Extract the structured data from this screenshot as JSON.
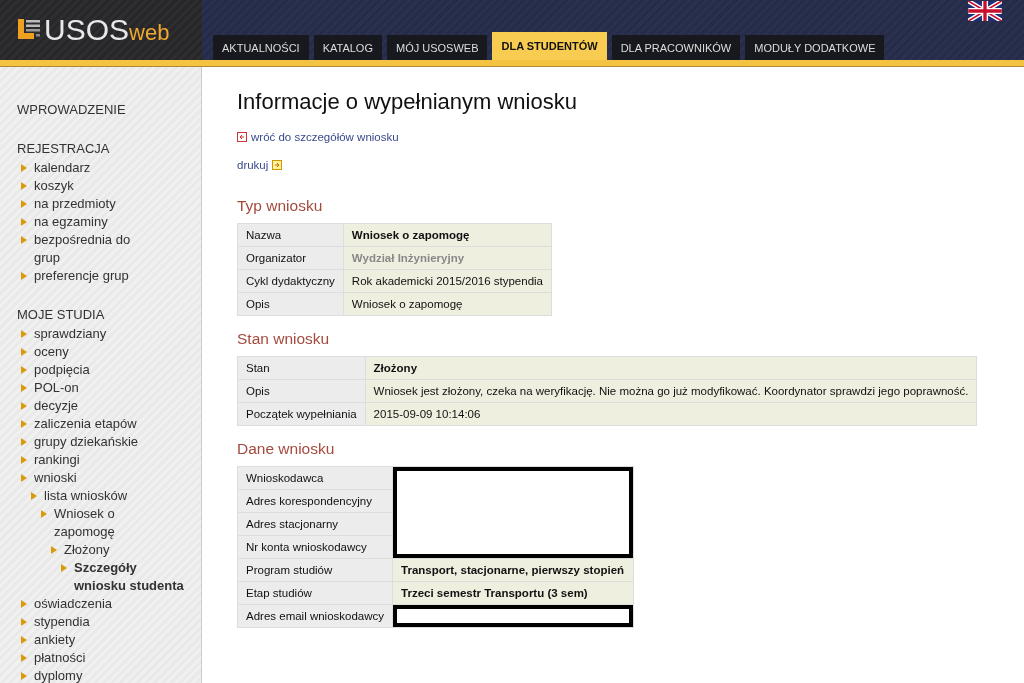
{
  "header": {
    "logo_main": "USOS",
    "logo_suffix": "web",
    "tabs": [
      {
        "label": "AKTUALNOŚCI",
        "selected": false
      },
      {
        "label": "KATALOG",
        "selected": false
      },
      {
        "label": "MÓJ USOSWEB",
        "selected": false
      },
      {
        "label": "DLA STUDENTÓW",
        "selected": true
      },
      {
        "label": "DLA PRACOWNIKÓW",
        "selected": false
      },
      {
        "label": "MODUŁY DODATKOWE",
        "selected": false
      }
    ]
  },
  "sidebar": {
    "sections": [
      {
        "heading": "WPROWADZENIE"
      },
      {
        "heading": "REJESTRACJA",
        "items": [
          {
            "label": "kalendarz",
            "selected": false
          },
          {
            "label": "koszyk",
            "selected": false
          },
          {
            "label": "na przedmioty",
            "selected": false
          },
          {
            "label": "na egzaminy",
            "selected": false
          },
          {
            "label": "bezpośrednia do grup",
            "selected": false
          },
          {
            "label": "preferencje grup",
            "selected": false
          }
        ]
      },
      {
        "heading": "MOJE STUDIA",
        "items": [
          {
            "label": "sprawdziany",
            "selected": false
          },
          {
            "label": "oceny",
            "selected": false
          },
          {
            "label": "podpięcia",
            "selected": false
          },
          {
            "label": "POL-on",
            "selected": false
          },
          {
            "label": "decyzje",
            "selected": false
          },
          {
            "label": "zaliczenia etapów",
            "selected": false
          },
          {
            "label": "grupy dziekańskie",
            "selected": false
          },
          {
            "label": "rankingi",
            "selected": false
          },
          {
            "label": "wnioski",
            "selected": false,
            "children": [
              {
                "label": "lista wniosków",
                "selected": false,
                "children": [
                  {
                    "label": "Wniosek o zapomogę",
                    "selected": false,
                    "children": [
                      {
                        "label": "Złożony",
                        "selected": false,
                        "children": [
                          {
                            "label": "Szczegóły wniosku studenta",
                            "selected": true
                          }
                        ]
                      }
                    ]
                  }
                ]
              }
            ]
          },
          {
            "label": "oświadczenia",
            "selected": false
          },
          {
            "label": "stypendia",
            "selected": false
          },
          {
            "label": "ankiety",
            "selected": false
          },
          {
            "label": "płatności",
            "selected": false
          },
          {
            "label": "dyplomy",
            "selected": false
          }
        ]
      }
    ]
  },
  "content": {
    "title": "Informacje o wypełnianym wniosku",
    "back_link": "wróć do szczegółów wniosku",
    "print_link": "drukuj",
    "sections": [
      {
        "heading": "Typ wniosku",
        "rows": [
          {
            "label": "Nazwa",
            "value": "Wniosek o zapomogę",
            "kind": "bold"
          },
          {
            "label": "Organizator",
            "value": "Wydział Inżynieryjny",
            "kind": "muted"
          },
          {
            "label": "Cykl dydaktyczny",
            "value": "Rok akademicki 2015/2016 stypendia",
            "kind": "plain"
          },
          {
            "label": "Opis",
            "value": "Wniosek o zapomogę",
            "kind": "plain"
          }
        ]
      },
      {
        "heading": "Stan wniosku",
        "rows": [
          {
            "label": "Stan",
            "value": "Złożony",
            "kind": "bold"
          },
          {
            "label": "Opis",
            "value": "Wniosek jest złożony, czeka na weryfikację. Nie można go już modyfikować. Koordynator sprawdzi jego poprawność.",
            "kind": "plain"
          },
          {
            "label": "Początek wypełniania",
            "value": "2015-09-09 10:14:06",
            "kind": "plain"
          }
        ]
      },
      {
        "heading": "Dane wniosku",
        "rows": [
          {
            "label": "Wnioskodawca",
            "kind": "redacted"
          },
          {
            "label": "Adres korespondencyjny",
            "kind": "redacted"
          },
          {
            "label": "Adres stacjonarny",
            "kind": "redacted"
          },
          {
            "label": "Nr konta wnioskodawcy",
            "kind": "redacted"
          },
          {
            "label": "Program studiów",
            "value": "Transport, stacjonarne, pierwszy stopień",
            "kind": "bold"
          },
          {
            "label": "Etap studiów",
            "value": "Trzeci semestr Transportu (3 sem)",
            "kind": "bold"
          },
          {
            "label": "Adres email wnioskodawcy",
            "kind": "redacted"
          }
        ]
      }
    ]
  }
}
